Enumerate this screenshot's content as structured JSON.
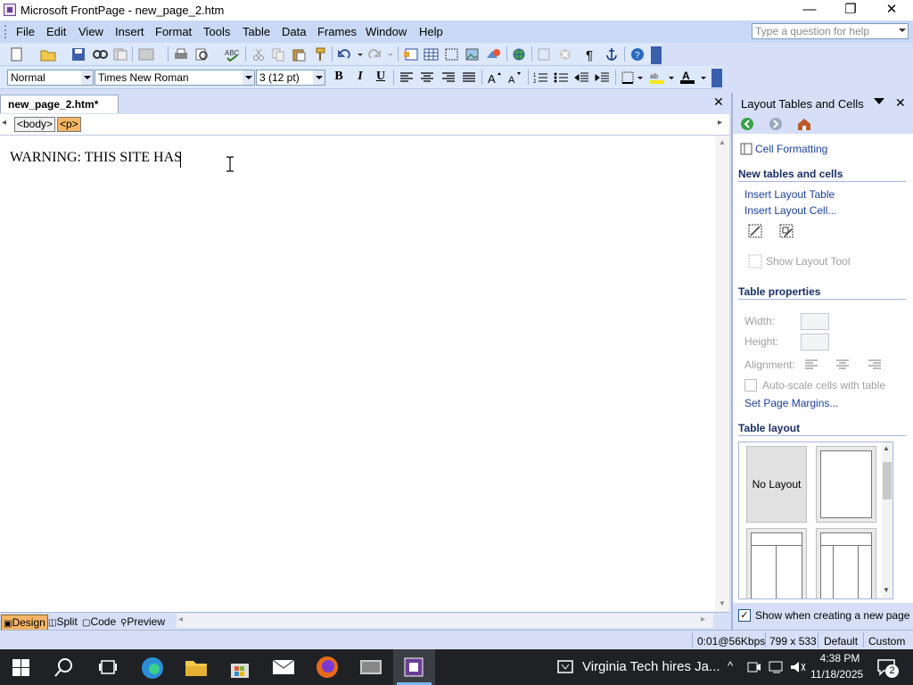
{
  "window": {
    "title": "Microsoft FrontPage - new_page_2.htm",
    "controls": {
      "minimize": "—",
      "restore": "❐",
      "close": "✕"
    }
  },
  "menubar": {
    "items": [
      "File",
      "Edit",
      "View",
      "Insert",
      "Format",
      "Tools",
      "Table",
      "Data",
      "Frames",
      "Window",
      "Help"
    ],
    "help_placeholder": "Type a question for help"
  },
  "format_toolbar": {
    "style": "Normal",
    "font": "Times New Roman",
    "size": "3  (12 pt)"
  },
  "document": {
    "tab_label": "new_page_2.htm*",
    "close_glyph": "✕",
    "tags": [
      "<body>",
      "<p>"
    ],
    "text": "WARNING: THIS SITE HAS"
  },
  "view_tabs": [
    "Design",
    "Split",
    "Code",
    "Preview"
  ],
  "task_pane": {
    "title": "Layout Tables and Cells",
    "cell_formatting": "Cell Formatting",
    "section_new": "New tables and cells",
    "insert_layout_table": "Insert Layout Table",
    "insert_layout_cell": "Insert Layout Cell...",
    "show_layout_tool": "Show Layout Tool",
    "section_props": "Table properties",
    "width_label": "Width:",
    "height_label": "Height:",
    "alignment_label": "Alignment:",
    "autoscale_label": "Auto-scale cells with table",
    "set_margins": "Set Page Margins...",
    "section_layout": "Table layout",
    "no_layout": "No Layout",
    "show_when_creating": "Show when creating a new page"
  },
  "statusbar": {
    "speed": "0:01@56Kbps",
    "dimensions": "799 x 533",
    "mode": "Default",
    "custom": "Custom"
  },
  "taskbar": {
    "news": "Virginia Tech hires Ja...",
    "time": "4:38 PM",
    "date": "11/18/2025",
    "notifications": "2"
  },
  "colors": {
    "toolbar_bg": "#dde8fb",
    "menubar_bg": "#c9d9f5",
    "selected_tag": "#f5b565",
    "link": "#1a3fa0",
    "taskbar_bg": "#1f2125"
  }
}
